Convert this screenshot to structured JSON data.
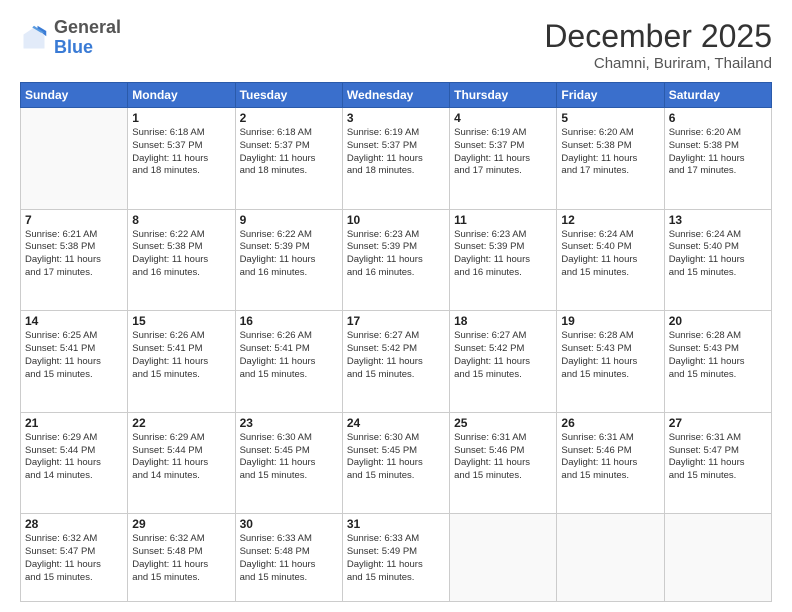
{
  "header": {
    "logo_general": "General",
    "logo_blue": "Blue",
    "month_title": "December 2025",
    "location": "Chamni, Buriram, Thailand"
  },
  "days_of_week": [
    "Sunday",
    "Monday",
    "Tuesday",
    "Wednesday",
    "Thursday",
    "Friday",
    "Saturday"
  ],
  "weeks": [
    [
      {
        "num": "",
        "info": ""
      },
      {
        "num": "1",
        "info": "Sunrise: 6:18 AM\nSunset: 5:37 PM\nDaylight: 11 hours\nand 18 minutes."
      },
      {
        "num": "2",
        "info": "Sunrise: 6:18 AM\nSunset: 5:37 PM\nDaylight: 11 hours\nand 18 minutes."
      },
      {
        "num": "3",
        "info": "Sunrise: 6:19 AM\nSunset: 5:37 PM\nDaylight: 11 hours\nand 18 minutes."
      },
      {
        "num": "4",
        "info": "Sunrise: 6:19 AM\nSunset: 5:37 PM\nDaylight: 11 hours\nand 17 minutes."
      },
      {
        "num": "5",
        "info": "Sunrise: 6:20 AM\nSunset: 5:38 PM\nDaylight: 11 hours\nand 17 minutes."
      },
      {
        "num": "6",
        "info": "Sunrise: 6:20 AM\nSunset: 5:38 PM\nDaylight: 11 hours\nand 17 minutes."
      }
    ],
    [
      {
        "num": "7",
        "info": "Sunrise: 6:21 AM\nSunset: 5:38 PM\nDaylight: 11 hours\nand 17 minutes."
      },
      {
        "num": "8",
        "info": "Sunrise: 6:22 AM\nSunset: 5:38 PM\nDaylight: 11 hours\nand 16 minutes."
      },
      {
        "num": "9",
        "info": "Sunrise: 6:22 AM\nSunset: 5:39 PM\nDaylight: 11 hours\nand 16 minutes."
      },
      {
        "num": "10",
        "info": "Sunrise: 6:23 AM\nSunset: 5:39 PM\nDaylight: 11 hours\nand 16 minutes."
      },
      {
        "num": "11",
        "info": "Sunrise: 6:23 AM\nSunset: 5:39 PM\nDaylight: 11 hours\nand 16 minutes."
      },
      {
        "num": "12",
        "info": "Sunrise: 6:24 AM\nSunset: 5:40 PM\nDaylight: 11 hours\nand 15 minutes."
      },
      {
        "num": "13",
        "info": "Sunrise: 6:24 AM\nSunset: 5:40 PM\nDaylight: 11 hours\nand 15 minutes."
      }
    ],
    [
      {
        "num": "14",
        "info": "Sunrise: 6:25 AM\nSunset: 5:41 PM\nDaylight: 11 hours\nand 15 minutes."
      },
      {
        "num": "15",
        "info": "Sunrise: 6:26 AM\nSunset: 5:41 PM\nDaylight: 11 hours\nand 15 minutes."
      },
      {
        "num": "16",
        "info": "Sunrise: 6:26 AM\nSunset: 5:41 PM\nDaylight: 11 hours\nand 15 minutes."
      },
      {
        "num": "17",
        "info": "Sunrise: 6:27 AM\nSunset: 5:42 PM\nDaylight: 11 hours\nand 15 minutes."
      },
      {
        "num": "18",
        "info": "Sunrise: 6:27 AM\nSunset: 5:42 PM\nDaylight: 11 hours\nand 15 minutes."
      },
      {
        "num": "19",
        "info": "Sunrise: 6:28 AM\nSunset: 5:43 PM\nDaylight: 11 hours\nand 15 minutes."
      },
      {
        "num": "20",
        "info": "Sunrise: 6:28 AM\nSunset: 5:43 PM\nDaylight: 11 hours\nand 15 minutes."
      }
    ],
    [
      {
        "num": "21",
        "info": "Sunrise: 6:29 AM\nSunset: 5:44 PM\nDaylight: 11 hours\nand 14 minutes."
      },
      {
        "num": "22",
        "info": "Sunrise: 6:29 AM\nSunset: 5:44 PM\nDaylight: 11 hours\nand 14 minutes."
      },
      {
        "num": "23",
        "info": "Sunrise: 6:30 AM\nSunset: 5:45 PM\nDaylight: 11 hours\nand 15 minutes."
      },
      {
        "num": "24",
        "info": "Sunrise: 6:30 AM\nSunset: 5:45 PM\nDaylight: 11 hours\nand 15 minutes."
      },
      {
        "num": "25",
        "info": "Sunrise: 6:31 AM\nSunset: 5:46 PM\nDaylight: 11 hours\nand 15 minutes."
      },
      {
        "num": "26",
        "info": "Sunrise: 6:31 AM\nSunset: 5:46 PM\nDaylight: 11 hours\nand 15 minutes."
      },
      {
        "num": "27",
        "info": "Sunrise: 6:31 AM\nSunset: 5:47 PM\nDaylight: 11 hours\nand 15 minutes."
      }
    ],
    [
      {
        "num": "28",
        "info": "Sunrise: 6:32 AM\nSunset: 5:47 PM\nDaylight: 11 hours\nand 15 minutes."
      },
      {
        "num": "29",
        "info": "Sunrise: 6:32 AM\nSunset: 5:48 PM\nDaylight: 11 hours\nand 15 minutes."
      },
      {
        "num": "30",
        "info": "Sunrise: 6:33 AM\nSunset: 5:48 PM\nDaylight: 11 hours\nand 15 minutes."
      },
      {
        "num": "31",
        "info": "Sunrise: 6:33 AM\nSunset: 5:49 PM\nDaylight: 11 hours\nand 15 minutes."
      },
      {
        "num": "",
        "info": ""
      },
      {
        "num": "",
        "info": ""
      },
      {
        "num": "",
        "info": ""
      }
    ]
  ]
}
